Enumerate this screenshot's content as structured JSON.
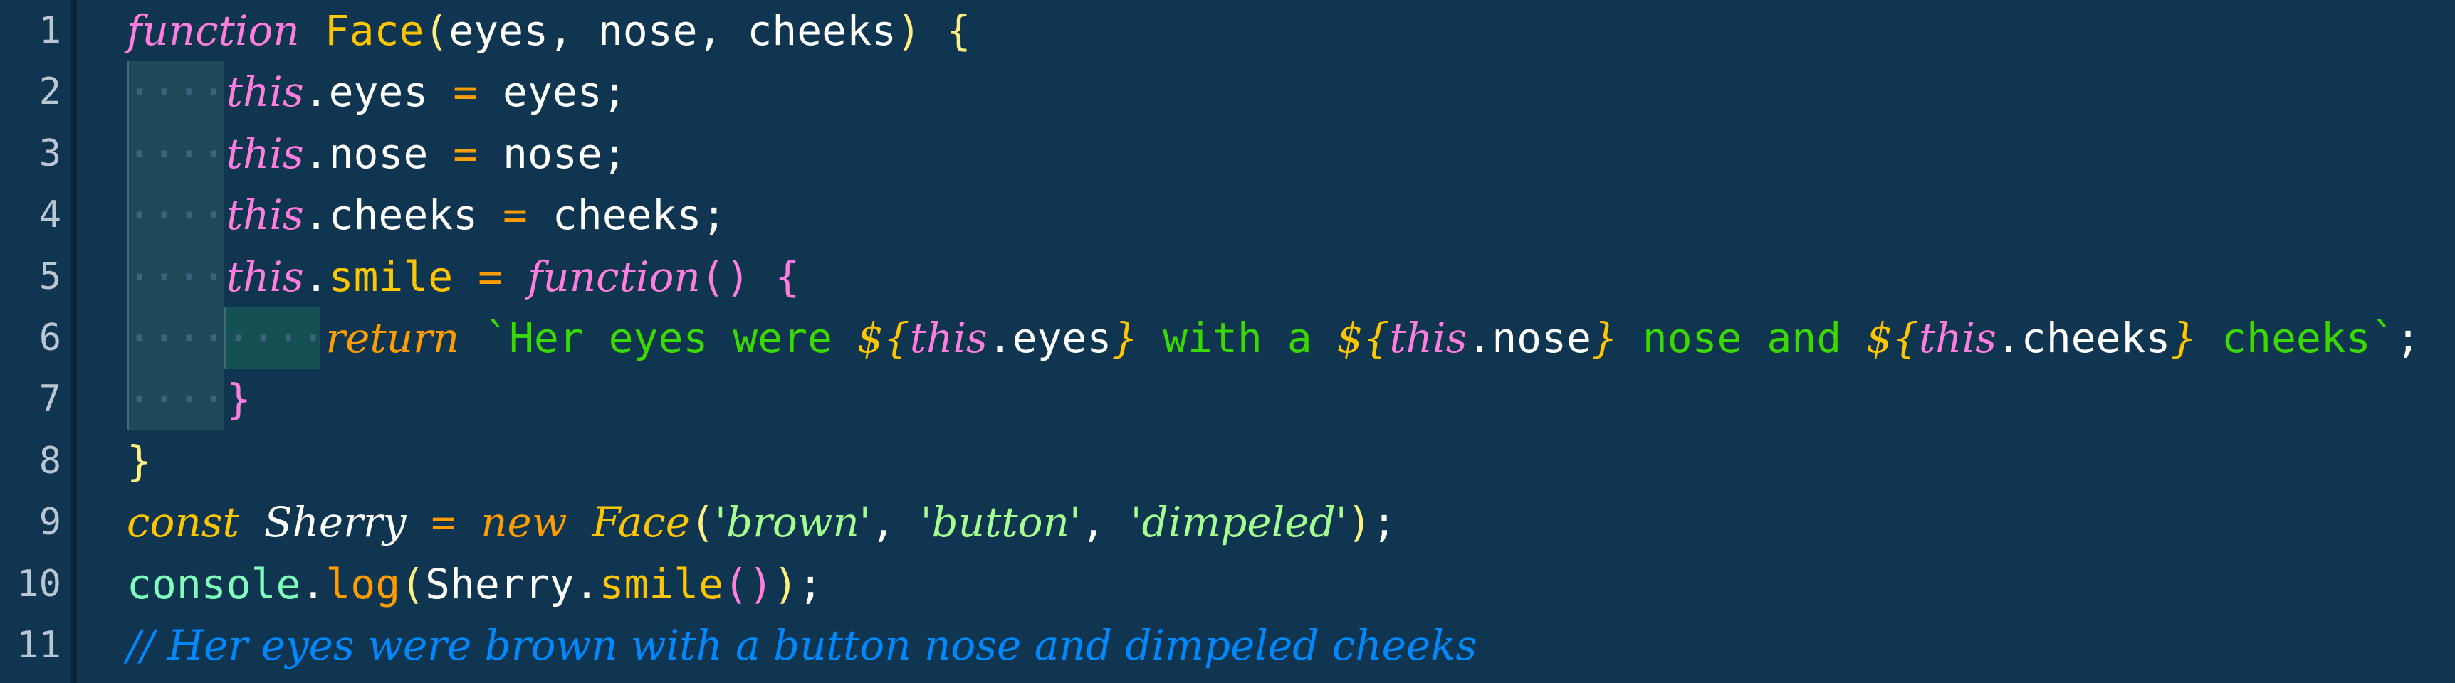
{
  "editor": {
    "line_numbers": [
      "1",
      "2",
      "3",
      "4",
      "5",
      "6",
      "7",
      "8",
      "9",
      "10",
      "11"
    ],
    "lines": [
      [
        {
          "t": "function",
          "c": "kw-it"
        },
        {
          "t": " ",
          "c": "ws"
        },
        {
          "t": "Face",
          "c": "fn"
        },
        {
          "t": "(",
          "c": "brace-y"
        },
        {
          "t": "eyes",
          "c": "ident"
        },
        {
          "t": ", ",
          "c": "punc"
        },
        {
          "t": "nose",
          "c": "ident"
        },
        {
          "t": ", ",
          "c": "punc"
        },
        {
          "t": "cheeks",
          "c": "ident"
        },
        {
          "t": ")",
          "c": "brace-y"
        },
        {
          "t": " ",
          "c": "ws"
        },
        {
          "t": "{",
          "c": "brace-y"
        }
      ],
      [
        {
          "t": "····",
          "c": "ws"
        },
        {
          "t": "this",
          "c": "this"
        },
        {
          "t": ".eyes",
          "c": "ident"
        },
        {
          "t": " ",
          "c": "ws"
        },
        {
          "t": "=",
          "c": "op"
        },
        {
          "t": " ",
          "c": "ws"
        },
        {
          "t": "eyes",
          "c": "ident"
        },
        {
          "t": ";",
          "c": "semi"
        }
      ],
      [
        {
          "t": "····",
          "c": "ws"
        },
        {
          "t": "this",
          "c": "this"
        },
        {
          "t": ".nose",
          "c": "ident"
        },
        {
          "t": " ",
          "c": "ws"
        },
        {
          "t": "=",
          "c": "op"
        },
        {
          "t": " ",
          "c": "ws"
        },
        {
          "t": "nose",
          "c": "ident"
        },
        {
          "t": ";",
          "c": "semi"
        }
      ],
      [
        {
          "t": "····",
          "c": "ws"
        },
        {
          "t": "this",
          "c": "this"
        },
        {
          "t": ".cheeks",
          "c": "ident"
        },
        {
          "t": " ",
          "c": "ws"
        },
        {
          "t": "=",
          "c": "op"
        },
        {
          "t": " ",
          "c": "ws"
        },
        {
          "t": "cheeks",
          "c": "ident"
        },
        {
          "t": ";",
          "c": "semi"
        }
      ],
      [
        {
          "t": "····",
          "c": "ws"
        },
        {
          "t": "this",
          "c": "this"
        },
        {
          "t": ".",
          "c": "ident"
        },
        {
          "t": "smile",
          "c": "fn"
        },
        {
          "t": " ",
          "c": "ws"
        },
        {
          "t": "=",
          "c": "op"
        },
        {
          "t": " ",
          "c": "ws"
        },
        {
          "t": "function",
          "c": "kw-it"
        },
        {
          "t": "()",
          "c": "paren-p"
        },
        {
          "t": " ",
          "c": "ws"
        },
        {
          "t": "{",
          "c": "brace-p"
        }
      ],
      [
        {
          "t": "········",
          "c": "ws"
        },
        {
          "t": "return",
          "c": "ret"
        },
        {
          "t": " ",
          "c": "ws"
        },
        {
          "t": "`Her eyes were ",
          "c": "str"
        },
        {
          "t": "${",
          "c": "interp"
        },
        {
          "t": "this",
          "c": "this"
        },
        {
          "t": ".eyes",
          "c": "ident"
        },
        {
          "t": "}",
          "c": "interp"
        },
        {
          "t": " with a ",
          "c": "str"
        },
        {
          "t": "${",
          "c": "interp"
        },
        {
          "t": "this",
          "c": "this"
        },
        {
          "t": ".nose",
          "c": "ident"
        },
        {
          "t": "}",
          "c": "interp"
        },
        {
          "t": " nose and ",
          "c": "str"
        },
        {
          "t": "${",
          "c": "interp"
        },
        {
          "t": "this",
          "c": "this"
        },
        {
          "t": ".cheeks",
          "c": "ident"
        },
        {
          "t": "}",
          "c": "interp"
        },
        {
          "t": " cheeks`",
          "c": "str"
        },
        {
          "t": ";",
          "c": "semi"
        }
      ],
      [
        {
          "t": "····",
          "c": "ws"
        },
        {
          "t": "}",
          "c": "brace-p"
        }
      ],
      [
        {
          "t": "}",
          "c": "brace-y"
        }
      ],
      [
        {
          "t": "const",
          "c": "const"
        },
        {
          "t": " ",
          "c": "ws"
        },
        {
          "t": "Sherry",
          "c": "sherry"
        },
        {
          "t": " ",
          "c": "ws"
        },
        {
          "t": "=",
          "c": "op"
        },
        {
          "t": " ",
          "c": "ws"
        },
        {
          "t": "new",
          "c": "new"
        },
        {
          "t": " ",
          "c": "ws"
        },
        {
          "t": "Face",
          "c": "const"
        },
        {
          "t": "(",
          "c": "brace-y"
        },
        {
          "t": "'brown'",
          "c": "strq"
        },
        {
          "t": ", ",
          "c": "punc"
        },
        {
          "t": "'button'",
          "c": "strq"
        },
        {
          "t": ", ",
          "c": "punc"
        },
        {
          "t": "'dimpeled'",
          "c": "strq"
        },
        {
          "t": ")",
          "c": "brace-y"
        },
        {
          "t": ";",
          "c": "semi"
        }
      ],
      [
        {
          "t": "console",
          "c": "console"
        },
        {
          "t": ".",
          "c": "punc"
        },
        {
          "t": "log",
          "c": "method"
        },
        {
          "t": "(",
          "c": "brace-y"
        },
        {
          "t": "Sherry",
          "c": "ident"
        },
        {
          "t": ".",
          "c": "punc"
        },
        {
          "t": "smile",
          "c": "fn"
        },
        {
          "t": "()",
          "c": "paren-p"
        },
        {
          "t": ")",
          "c": "brace-y"
        },
        {
          "t": ";",
          "c": "semi"
        }
      ],
      [
        {
          "t": "// Her eyes were brown with a button nose and dimpeled cheeks",
          "c": "comment"
        }
      ]
    ]
  },
  "colors": {
    "background": "#0f3550",
    "line_number": "#b9c6d2",
    "keyword": "#ff7edb",
    "function": "#ffc600",
    "string": "#3ad900",
    "comment": "#0088ff"
  }
}
